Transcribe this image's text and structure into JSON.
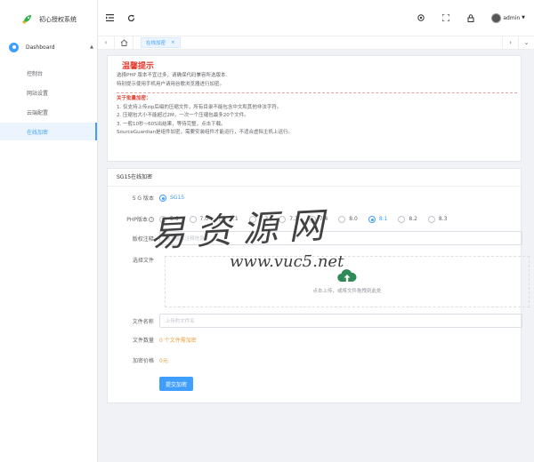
{
  "app": {
    "title": "初心授权系统"
  },
  "sidebar": {
    "parent": "Dashboard",
    "items": [
      {
        "label": "控制台"
      },
      {
        "label": "网站设置"
      },
      {
        "label": "云端配置"
      },
      {
        "label": "在线加密"
      }
    ]
  },
  "header": {
    "user": "admin"
  },
  "tabs": [
    {
      "label": "在线加密"
    }
  ],
  "notice": {
    "title": "温馨提示",
    "lines": [
      "选择PHP 版本不宜过多，请确保代码兼容所选版本.",
      "特别提示使用手机用户请用谷歌浏览器进行加密。"
    ],
    "subtitle": "关于批量加密：",
    "rules": [
      "1. 仅支持上传zip后缀的压缩文件，所有目录不能包含中文和其他非法字符。",
      "2. 压缩包大小不能超过2M，一次一个压缩包最多20个文件。",
      "3. 一般10秒~60S出结果，等待完整，点击下载。",
      "SourceGuardian是组件加密，需要安装组件才能运行，不适合虚拟主机上运行。"
    ]
  },
  "form": {
    "card_title": "SG15在线加密",
    "sg_label": "S G 版本",
    "sg_option": "SG15",
    "php_label": "PHP版本",
    "php_versions": [
      "5.6",
      "7.0",
      "7.1",
      "7.2",
      "7.3",
      "7.4",
      "8.0",
      "8.1",
      "8.2",
      "8.3"
    ],
    "php_selected": "8.1",
    "license_label": "版权注释",
    "license_placeholder": "输入版权注释信息",
    "file_label": "选择文件",
    "upload_hint": "点击上传，或将文件拖拽到此处",
    "filename_label": "文件名称",
    "filename_placeholder": "上传的文件名",
    "count_label": "文件数量",
    "count_value": "0 个文件需加密",
    "price_label": "加密价格",
    "price_value": "0元",
    "submit": "提交加密"
  },
  "watermark": {
    "cn": "易资源网",
    "url": "www.vuc5.net"
  },
  "colors": {
    "primary": "#409eff",
    "warning": "#e6a23c",
    "danger": "#e43d30"
  }
}
